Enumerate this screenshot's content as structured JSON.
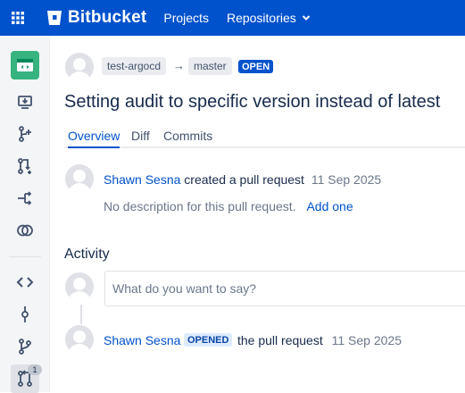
{
  "topbar": {
    "product_name": "Bitbucket",
    "nav": [
      "Projects",
      "Repositories"
    ]
  },
  "sidebar": {
    "items": [
      {
        "icon": "repository-icon"
      },
      {
        "icon": "source-download-icon"
      },
      {
        "icon": "create-branch-icon"
      },
      {
        "icon": "create-pull-request-icon"
      },
      {
        "icon": "fork-icon"
      },
      {
        "icon": "compare-icon"
      },
      {
        "icon": "source-code-icon"
      },
      {
        "icon": "commits-icon"
      },
      {
        "icon": "branches-icon"
      },
      {
        "icon": "pull-requests-icon",
        "badge": "1"
      }
    ]
  },
  "pull_request": {
    "source_branch": "test-argocd",
    "arrow": "→",
    "target_branch": "master",
    "status": "OPEN",
    "title": "Setting audit to specific version instead of latest",
    "tabs": [
      "Overview",
      "Diff",
      "Commits"
    ],
    "author": "Shawn Sesna",
    "created_text": "created a pull request",
    "created_date": "11 Sep 2025",
    "description": "No description for this pull request.",
    "add_description": "Add one"
  },
  "activity": {
    "heading": "Activity",
    "comment_placeholder": "What do you want to say?",
    "event": {
      "author": "Shawn Sesna",
      "badge": "OPENED",
      "text": "the pull request",
      "date": "11 Sep 2025"
    }
  },
  "colors": {
    "brand": "#0052cc",
    "repo_icon_bg": "#36b37e",
    "open_badge": "#0052cc"
  }
}
